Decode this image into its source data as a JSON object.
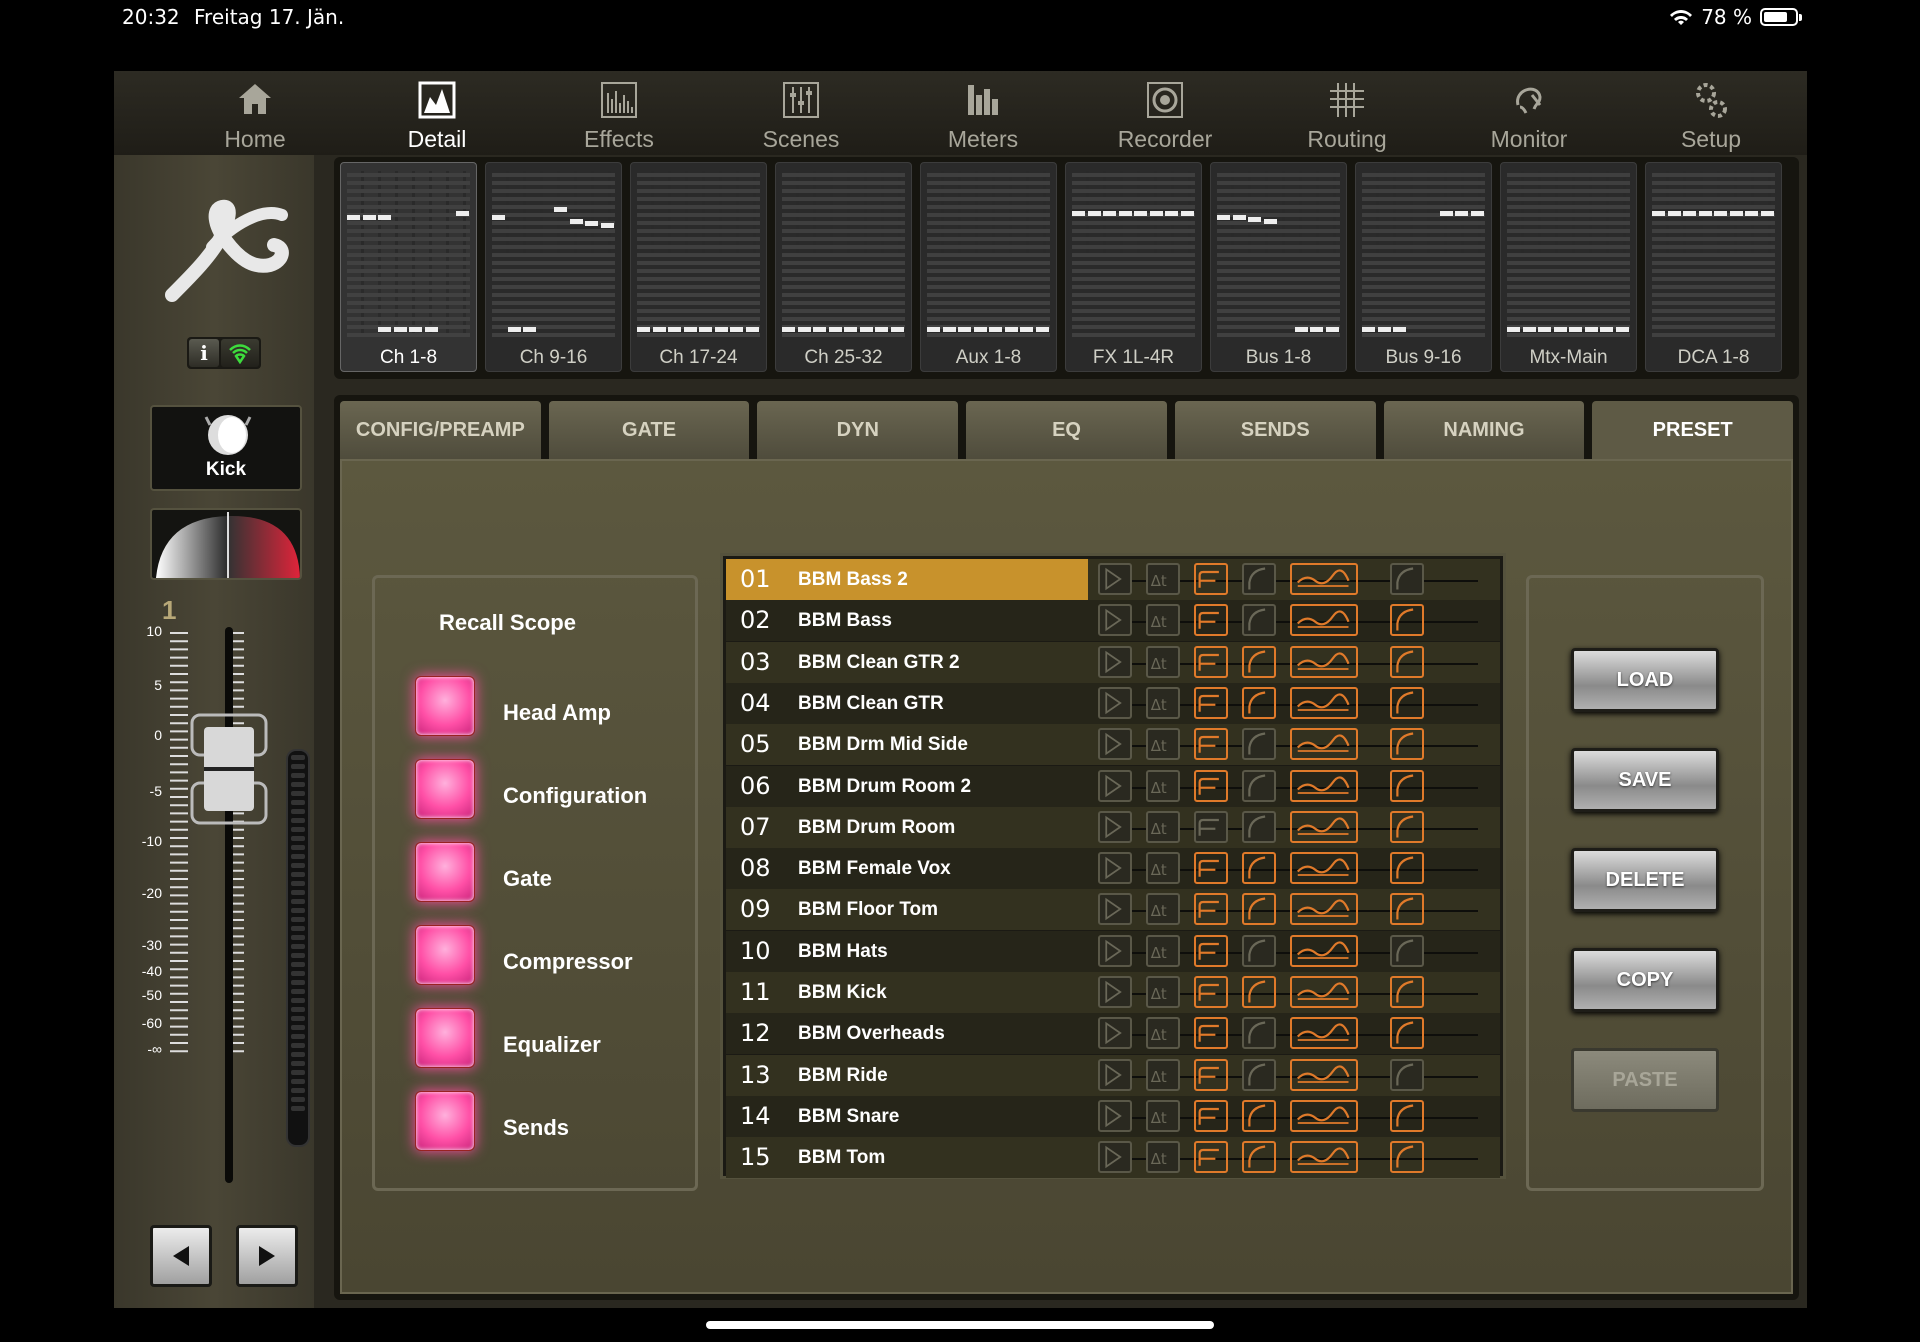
{
  "status": {
    "time": "20:32",
    "date": "Freitag 17. Jän.",
    "battery": "78 %",
    "battery_level": 0.78
  },
  "nav": {
    "items": [
      {
        "label": "Home",
        "icon": "home-icon"
      },
      {
        "label": "Detail",
        "icon": "detail-icon"
      },
      {
        "label": "Effects",
        "icon": "effects-icon"
      },
      {
        "label": "Scenes",
        "icon": "scenes-icon"
      },
      {
        "label": "Meters",
        "icon": "meters-icon"
      },
      {
        "label": "Recorder",
        "icon": "recorder-icon"
      },
      {
        "label": "Routing",
        "icon": "routing-icon"
      },
      {
        "label": "Monitor",
        "icon": "monitor-icon"
      },
      {
        "label": "Setup",
        "icon": "setup-icon"
      }
    ],
    "active": "Detail"
  },
  "meter_groups": [
    "Ch 1-8",
    "Ch 9-16",
    "Ch 17-24",
    "Ch 25-32",
    "Aux 1-8",
    "FX 1L-4R",
    "Bus 1-8",
    "Bus 9-16",
    "Mtx-Main",
    "DCA 1-8"
  ],
  "channel": {
    "name": "Kick",
    "number": "1",
    "info_label": "i"
  },
  "fader_scale": [
    "10",
    "5",
    "0",
    "-5",
    "-10",
    "-20",
    "-30",
    "-40",
    "-50",
    "-60",
    "-∞"
  ],
  "tabs": [
    "CONFIG/PREAMP",
    "GATE",
    "DYN",
    "EQ",
    "SENDS",
    "NAMING",
    "PRESET"
  ],
  "active_tab": "PRESET",
  "recall_scope": {
    "title": "Recall Scope",
    "items": [
      "Head Amp",
      "Configuration",
      "Gate",
      "Compressor",
      "Equalizer",
      "Sends"
    ]
  },
  "presets": [
    {
      "num": "01",
      "name": "BBM Bass 2",
      "flags": [
        0,
        0,
        1,
        0,
        1,
        0
      ]
    },
    {
      "num": "02",
      "name": "BBM Bass",
      "flags": [
        0,
        0,
        1,
        0,
        1,
        1
      ]
    },
    {
      "num": "03",
      "name": "BBM Clean GTR 2",
      "flags": [
        0,
        0,
        1,
        1,
        1,
        1
      ]
    },
    {
      "num": "04",
      "name": "BBM Clean GTR",
      "flags": [
        0,
        0,
        1,
        1,
        1,
        1
      ]
    },
    {
      "num": "05",
      "name": "BBM Drm Mid Side",
      "flags": [
        0,
        0,
        1,
        0,
        1,
        1
      ]
    },
    {
      "num": "06",
      "name": "BBM Drum Room 2",
      "flags": [
        0,
        0,
        1,
        0,
        1,
        1
      ]
    },
    {
      "num": "07",
      "name": "BBM Drum Room",
      "flags": [
        0,
        0,
        0,
        0,
        1,
        1
      ]
    },
    {
      "num": "08",
      "name": "BBM Female Vox",
      "flags": [
        0,
        0,
        1,
        1,
        1,
        1
      ]
    },
    {
      "num": "09",
      "name": "BBM Floor Tom",
      "flags": [
        0,
        0,
        1,
        1,
        1,
        1
      ]
    },
    {
      "num": "10",
      "name": "BBM Hats",
      "flags": [
        0,
        0,
        1,
        0,
        1,
        0
      ]
    },
    {
      "num": "11",
      "name": "BBM Kick",
      "flags": [
        0,
        0,
        1,
        1,
        1,
        1
      ]
    },
    {
      "num": "12",
      "name": "BBM Overheads",
      "flags": [
        0,
        0,
        1,
        0,
        1,
        1
      ]
    },
    {
      "num": "13",
      "name": "BBM Ride",
      "flags": [
        0,
        0,
        1,
        0,
        1,
        0
      ]
    },
    {
      "num": "14",
      "name": "BBM Snare",
      "flags": [
        0,
        0,
        1,
        1,
        1,
        1
      ]
    },
    {
      "num": "15",
      "name": "BBM Tom",
      "flags": [
        0,
        0,
        1,
        1,
        1,
        1
      ]
    }
  ],
  "selected_preset": "01",
  "actions": [
    {
      "label": "LOAD",
      "enabled": true
    },
    {
      "label": "SAVE",
      "enabled": true
    },
    {
      "label": "DELETE",
      "enabled": true
    },
    {
      "label": "COPY",
      "enabled": true
    },
    {
      "label": "PASTE",
      "enabled": false
    }
  ],
  "colors": {
    "accent": "#c8922c",
    "led_pink": "#ff4fa6",
    "icon_on": "#e07a2a"
  }
}
